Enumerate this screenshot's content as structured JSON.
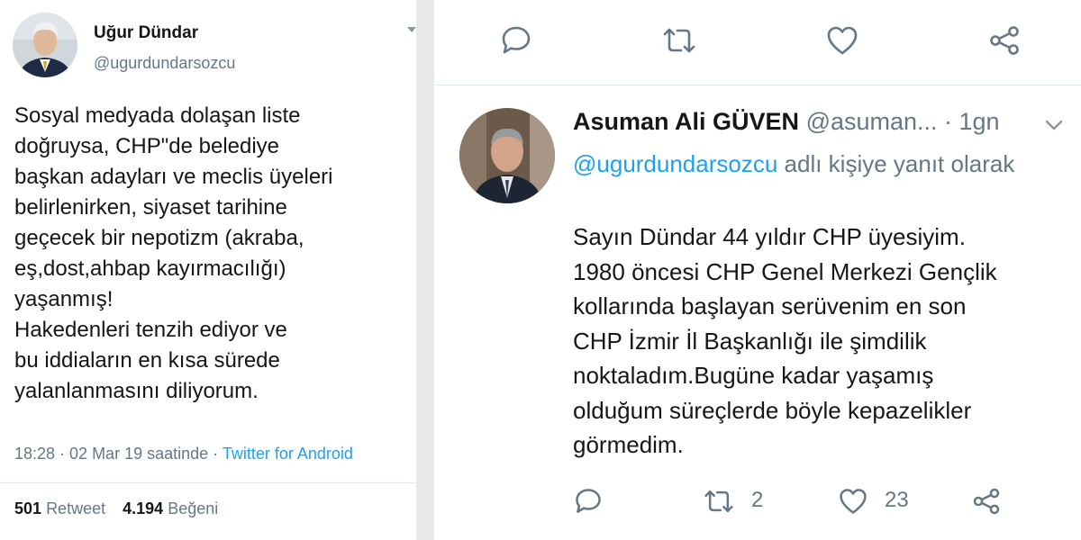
{
  "left_tweet": {
    "author_name": "Uğur Dündar",
    "author_handle": "@ugurdundarsozcu",
    "text_lines": [
      "Sosyal medyada dolaşan liste",
      "doğruysa, CHP\"de belediye",
      "başkan adayları ve meclis üyeleri",
      "belirlenirken, siyaset tarihine",
      "geçecek bir nepotizm (akraba,",
      "eş,dost,ahbap kayırmacılığı)",
      "yaşanmış!",
      "Hakedenleri tenzih ediyor ve",
      "bu iddiaların en kısa sürede",
      "yalanlanmasını diliyorum."
    ],
    "timestamp": "18:28 · 02 Mar 19 saatinde · ",
    "source": "Twitter for Android",
    "retweet_count": "501",
    "retweet_label": "Retweet",
    "like_count": "4.194",
    "like_label": "Beğeni"
  },
  "reply": {
    "author_name": "Asuman Ali GÜVEN",
    "author_handle": "@asuman...",
    "time": " · 1gn",
    "mention": "@ugurdundarsozcu",
    "reply_suffix": " adlı kişiye yanıt olarak",
    "text_lines": [
      "Sayın Dündar 44 yıldır CHP üyesiyim.",
      "1980 öncesi CHP Genel Merkezi Gençlik",
      "kollarında başlayan serüvenim en son",
      "CHP İzmir İl Başkanlığı ile şimdilik",
      "noktaladım.Bugüne kadar yaşamış",
      "olduğum süreçlerde böyle kepazelikler",
      "görmedim."
    ],
    "retweet_count": "2",
    "like_count": "23"
  },
  "icons": [
    "reply-icon",
    "retweet-icon",
    "like-icon",
    "share-icon",
    "chevron-down-icon",
    "caret-down-icon"
  ],
  "colors": {
    "link": "#1da1f2",
    "secondary_text": "#657786",
    "icon": "#657786"
  }
}
